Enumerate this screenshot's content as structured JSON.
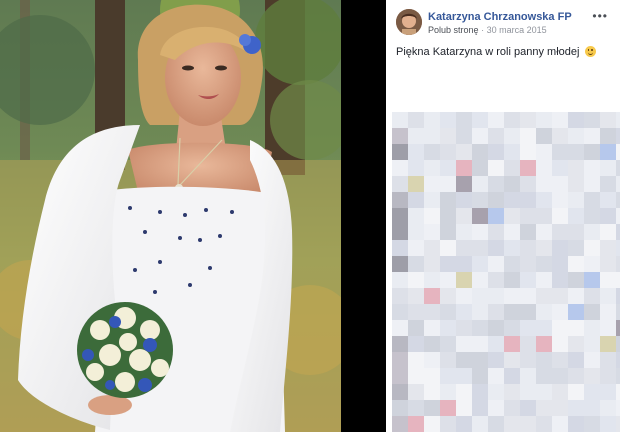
{
  "post": {
    "author": "Katarzyna Chrzanowska FP",
    "like_page": "Polub stronę",
    "separator": "·",
    "date": "30 marca 2015",
    "more_icon": "more-icon",
    "caption": "Piękna Katarzyna w roli panny młodej",
    "emoji": "smiley-emoji"
  },
  "photo": {
    "subject": "bride-with-bouquet"
  },
  "comments": {
    "obscured": true
  },
  "colors": {
    "author_link": "#365899",
    "meta": "#90949c",
    "text": "#1d2129",
    "background": "#000000",
    "panel": "#ffffff"
  }
}
